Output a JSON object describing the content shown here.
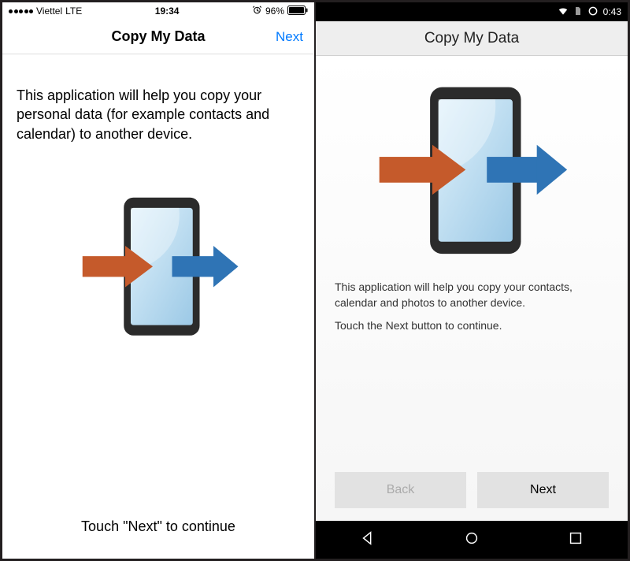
{
  "ios": {
    "status": {
      "carrier": "Viettel",
      "network": "LTE",
      "time": "19:34",
      "battery_pct": "96%"
    },
    "nav": {
      "title": "Copy My Data",
      "next": "Next"
    },
    "description": "This application will help you copy your personal data (for example contacts and calendar) to another device.",
    "footer": "Touch \"Next\" to continue"
  },
  "android": {
    "status": {
      "time": "0:43"
    },
    "appbar_title": "Copy My Data",
    "description_1": "This application will help you copy your contacts, calendar and photos to another device.",
    "description_2": "Touch the Next button to continue.",
    "buttons": {
      "back": "Back",
      "next": "Next"
    }
  },
  "colors": {
    "ios_link": "#007aff",
    "arrow_in": "#c55a2b",
    "arrow_out": "#2f74b5"
  }
}
